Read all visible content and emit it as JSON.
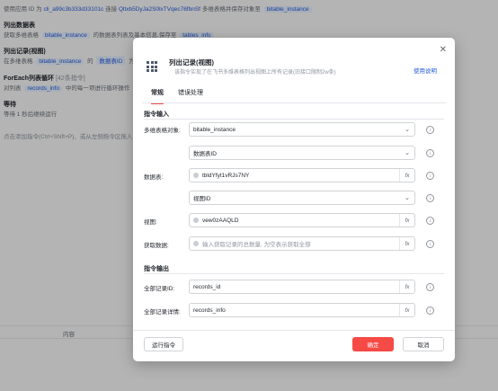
{
  "background": {
    "line1": {
      "prefix": "使用应用 ID 为",
      "app_id": "cli_a99c3b333d33101c",
      "mid": "连接",
      "token": "Qltxb5DyJa2S0lxTVqec76fbnSf",
      "suffix": "多维表格并保存对象至",
      "obj": "bitable_instance"
    },
    "step2_title": "列出数据表",
    "line3": {
      "prefix": "获取多维表格",
      "obj": "bitable_instance",
      "mid": "的数据表列表及基本信息,保存至",
      "target": "tables_info"
    },
    "step4_title": "列出记录(视图)",
    "line5": {
      "prefix": "在多维表格",
      "obj": "bitable_instance",
      "mid": "的",
      "field": "数据表ID",
      "suffix": "为"
    },
    "step6_title": "ForEach列表循环",
    "step6_count": "[42条指令]",
    "line7": {
      "prefix": "对列表",
      "obj": "records_info",
      "suffix": "中的每一项进行循环操作"
    },
    "step8_title": "等待",
    "line9": "等待 1 秒后继续运行",
    "hint": "点击添加指令(Ctrl+Shift+P)、或从左侧拖令区拖入",
    "table_header": "内容"
  },
  "modal": {
    "title": "列出记录(视图)",
    "subtitle": "该指令实现了在飞书多维表格列出视图上所有记录(旧接口限制2w条)",
    "help_link": "使用说明",
    "tabs": [
      {
        "label": "常规",
        "active": true
      },
      {
        "label": "错误处理",
        "active": false
      }
    ],
    "input_section": "指令输入",
    "output_section": "指令输出",
    "fields": {
      "bitable_label": "多维表格对象:",
      "bitable_value": "bitable_instance",
      "table_select": "数据表ID",
      "table_label": "数据表:",
      "table_value": "tbldYfyt1vRJs7NY",
      "view_select": "视图ID",
      "view_label": "视图:",
      "view_value": "vew0zAAQLD",
      "count_label": "获取数据:",
      "count_placeholder": "输入获取记录的总数量, 为空表示获取全部",
      "records_id_label": "全部记录ID:",
      "records_id_value": "records_id",
      "records_info_label": "全部记录详情:",
      "records_info_value": "records_info"
    },
    "fx": "fx",
    "buttons": {
      "run": "运行指令",
      "ok": "确定",
      "cancel": "取消"
    }
  },
  "icons": {
    "close": "close-icon",
    "logo": "grid-icon",
    "chevron": "chevron-down-icon",
    "info": "info-icon",
    "variable": "variable-icon"
  },
  "colors": {
    "accent": "#245bdb",
    "primary": "#f54a45"
  }
}
